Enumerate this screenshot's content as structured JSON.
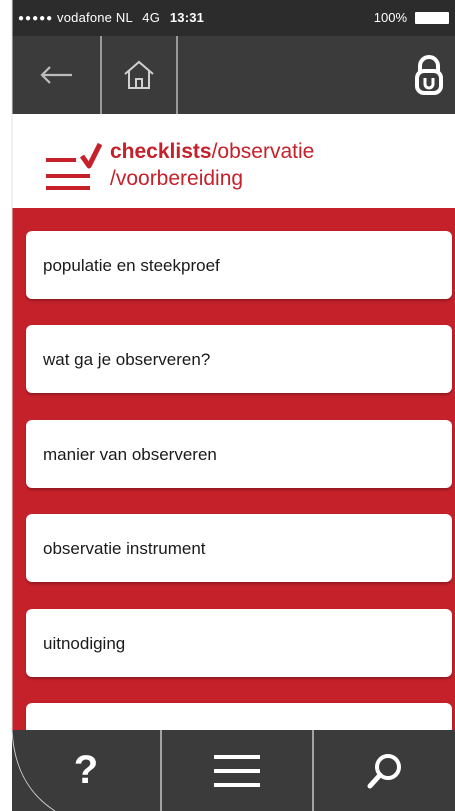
{
  "status_bar": {
    "carrier": "vodafone NL",
    "network": "4G",
    "time": "13:31",
    "battery": "100%"
  },
  "nav": {
    "back_icon": "arrow-left-icon",
    "home_icon": "home-icon",
    "lock_icon": "lock-icon"
  },
  "header": {
    "title_bold": "checklists",
    "title_rest": "/observatie",
    "subtitle": "/voorbereiding",
    "logo_icon": "checklist-icon"
  },
  "list": {
    "items": [
      {
        "label": "populatie en steekproef"
      },
      {
        "label": "wat ga je observeren?"
      },
      {
        "label": "manier van observeren"
      },
      {
        "label": "observatie instrument"
      },
      {
        "label": "uitnodiging"
      },
      {
        "label": ""
      }
    ]
  },
  "bottom_bar": {
    "help_label": "?",
    "menu_icon": "hamburger-menu-icon",
    "search_icon": "search-icon"
  },
  "colors": {
    "accent": "#c4212b",
    "bar": "#3b3b3b"
  }
}
